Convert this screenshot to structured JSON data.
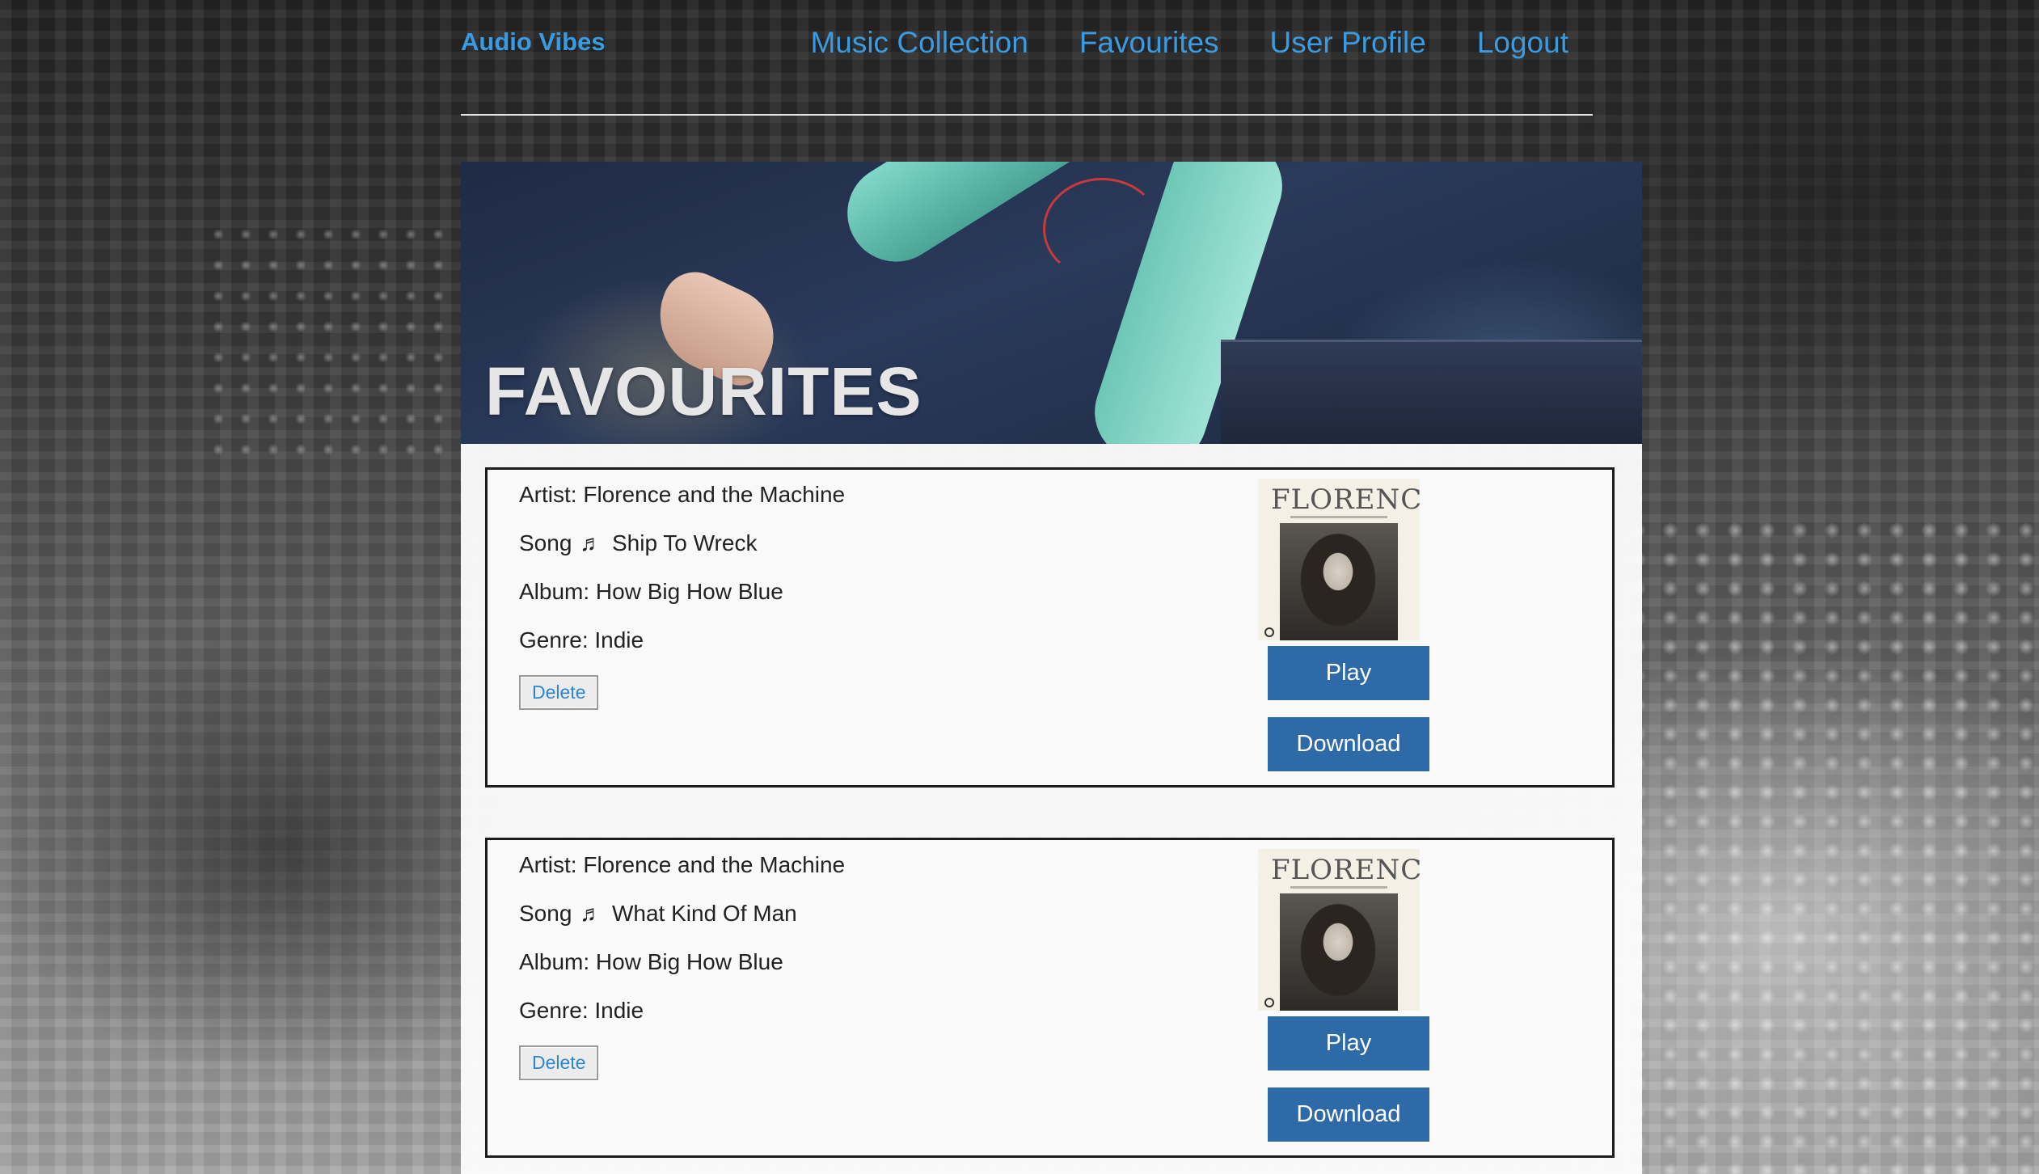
{
  "nav": {
    "brand": "Audio Vibes",
    "links": [
      "Music Collection",
      "Favourites",
      "User Profile",
      "Logout"
    ]
  },
  "hero": {
    "title": "FAVOURITES"
  },
  "favourites": [
    {
      "artist_label": "Artist: Florence and the Machine",
      "song_prefix": "Song",
      "song_title": "Ship To Wreck",
      "album_label": "Album: How Big How Blue",
      "genre_label": "Genre: Indie",
      "cover_text": "FLORENCE",
      "delete_label": "Delete",
      "play_label": "Play",
      "download_label": "Download"
    },
    {
      "artist_label": "Artist: Florence and the Machine",
      "song_prefix": "Song",
      "song_title": "What Kind Of Man",
      "album_label": "Album: How Big How Blue",
      "genre_label": "Genre: Indie",
      "cover_text": "FLORENCE",
      "delete_label": "Delete",
      "play_label": "Play",
      "download_label": "Download"
    }
  ],
  "icons": {
    "music_note": "♬"
  },
  "colors": {
    "link": "#3a9be0",
    "button": "#2f6aa8",
    "delete_text": "#2f86d0"
  }
}
